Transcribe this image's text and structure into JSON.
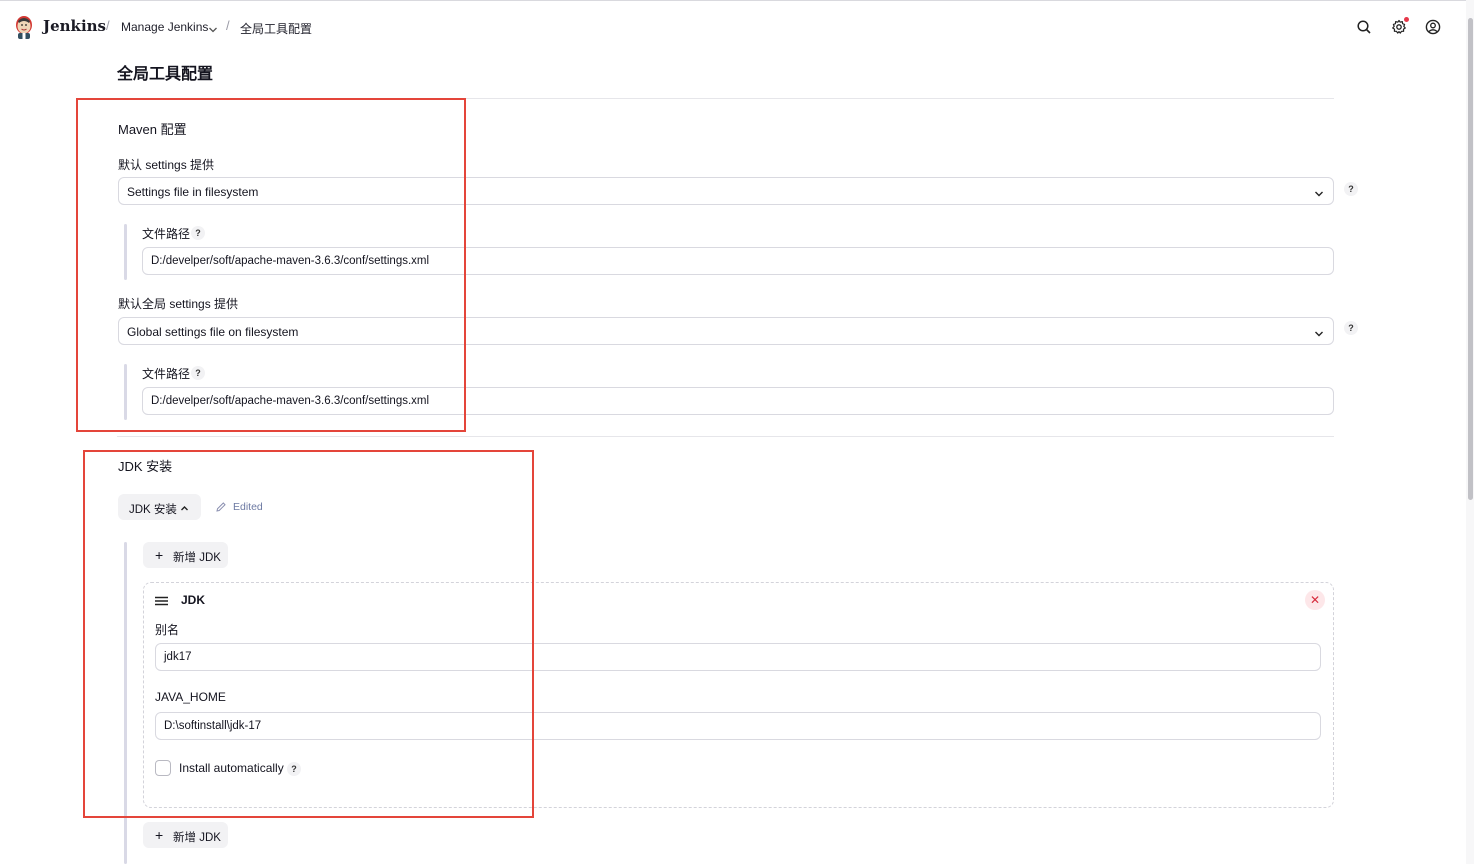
{
  "header": {
    "brand": "Jenkins",
    "breadcrumb": [
      {
        "label": "Manage Jenkins"
      },
      {
        "label": "全局工具配置"
      }
    ],
    "icons": [
      "search-icon",
      "gear-icon",
      "user-icon"
    ]
  },
  "page": {
    "title": "全局工具配置"
  },
  "maven": {
    "title": "Maven 配置",
    "settings_label": "默认 settings 提供",
    "settings_select": "Settings file in filesystem",
    "settings_path_label": "文件路径",
    "settings_path": "D:/develper/soft/apache-maven-3.6.3/conf/settings.xml",
    "global_settings_label": "默认全局 settings 提供",
    "global_settings_select": "Global settings file on filesystem",
    "global_path_label": "文件路径",
    "global_path": "D:/develper/soft/apache-maven-3.6.3/conf/settings.xml"
  },
  "jdk": {
    "title": "JDK 安装",
    "toggle_label": "JDK 安装",
    "edited": "Edited",
    "add_label": "新增 JDK",
    "item": {
      "title": "JDK",
      "alias_label": "别名",
      "alias_value": "jdk17",
      "home_label": "JAVA_HOME",
      "home_value": "D:\\softinstall\\jdk-17",
      "install_label": "Install automatically"
    }
  },
  "help_mark": "?",
  "colors": {
    "annotation_red": "#e4453a",
    "accent": "#14141f"
  }
}
